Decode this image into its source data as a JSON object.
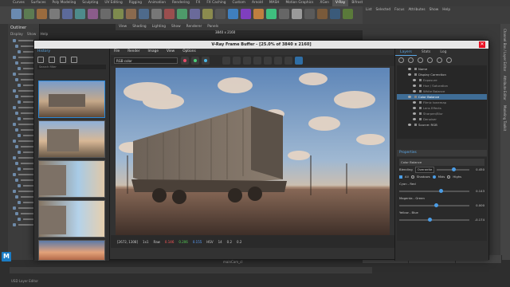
{
  "maya": {
    "shelf_tabs": [
      "Curves",
      "Surfaces",
      "Poly Modeling",
      "Sculpting",
      "UV Editing",
      "Rigging",
      "Animation",
      "Rendering",
      "FX",
      "FX Caching",
      "Custom",
      "Arnold",
      "MASH",
      "Motion Graphics",
      "XGen",
      "V-Ray",
      "Bifrost"
    ],
    "active_shelf_tab": "V-Ray",
    "outliner_title": "Outliner",
    "outliner_menu": [
      "Display",
      "Show",
      "Help"
    ],
    "viewport_menu": [
      "View",
      "Shading",
      "Lighting",
      "Show",
      "Renderer",
      "Panels"
    ],
    "resolution": "3840 x 2160",
    "right_panel_menu": [
      "List",
      "Selected",
      "Focus",
      "Attributes",
      "Show",
      "Help"
    ],
    "right_vertical_tabs": [
      "Channel Box / Layer Editor",
      "Attribute Editor",
      "Modeling Toolkit"
    ],
    "attr_buttons": [
      "Select",
      "Load Attributes",
      "Copy Tab"
    ],
    "bottom_file": "mainCam_cl",
    "usd_label": "USD Layer Editor",
    "maya_logo": "M"
  },
  "vfb": {
    "title": "V-Ray Frame Buffer - [25.0% of 3840 x 2160]",
    "menu": [
      "File",
      "Render",
      "Image",
      "View",
      "Options"
    ],
    "channel": "RGB color",
    "history_header": "History",
    "history_search_placeholder": "Search filter",
    "status": {
      "coords": "[2672, 1308]",
      "mode": "1x1",
      "colorspace": "Raw",
      "r": "0.146",
      "g": "0.206",
      "b": "0.155",
      "format": "HSV",
      "h": "14",
      "s": "0.2",
      "v": "0.2"
    },
    "layers": {
      "tabs": [
        "Layers",
        "Stats",
        "Log"
      ],
      "active_tab": "Layers",
      "tree": [
        {
          "label": "Name",
          "sub": false,
          "sel": false
        },
        {
          "label": "Display Correction",
          "sub": false,
          "sel": false
        },
        {
          "label": "Exposure",
          "sub": true,
          "sel": false
        },
        {
          "label": "Hue / Saturation",
          "sub": true,
          "sel": false
        },
        {
          "label": "White Balance",
          "sub": true,
          "sel": false
        },
        {
          "label": "Color Balance",
          "sub": false,
          "sel": true
        },
        {
          "label": "Filmic tonemap",
          "sub": true,
          "sel": false
        },
        {
          "label": "Lens Effects",
          "sub": true,
          "sel": false
        },
        {
          "label": "Sharpen/Blur",
          "sub": true,
          "sel": false
        },
        {
          "label": "Denoiser",
          "sub": true,
          "sel": false
        },
        {
          "label": "Source: RGB",
          "sub": false,
          "sel": false
        }
      ]
    },
    "properties": {
      "header": "Properties",
      "section": "Color Balance",
      "blending_label": "Blending",
      "blending_value": "Overwrite",
      "blending_amount": "0.450",
      "tone_all": "All",
      "tone_shadows": "Shadows",
      "tone_mids": "Mids",
      "tone_highs": "Highs",
      "cyan_red_label": "Cyan - Red",
      "cyan_red": "0.143",
      "magenta_green_label": "Magenta - Green",
      "magenta_green": "0.000",
      "yellow_blue_label": "Yellow - Blue",
      "yellow_blue": "-0.174",
      "cyan_red_level": 0.57,
      "magenta_green_level": 0.5,
      "yellow_blue_level": 0.41
    }
  }
}
